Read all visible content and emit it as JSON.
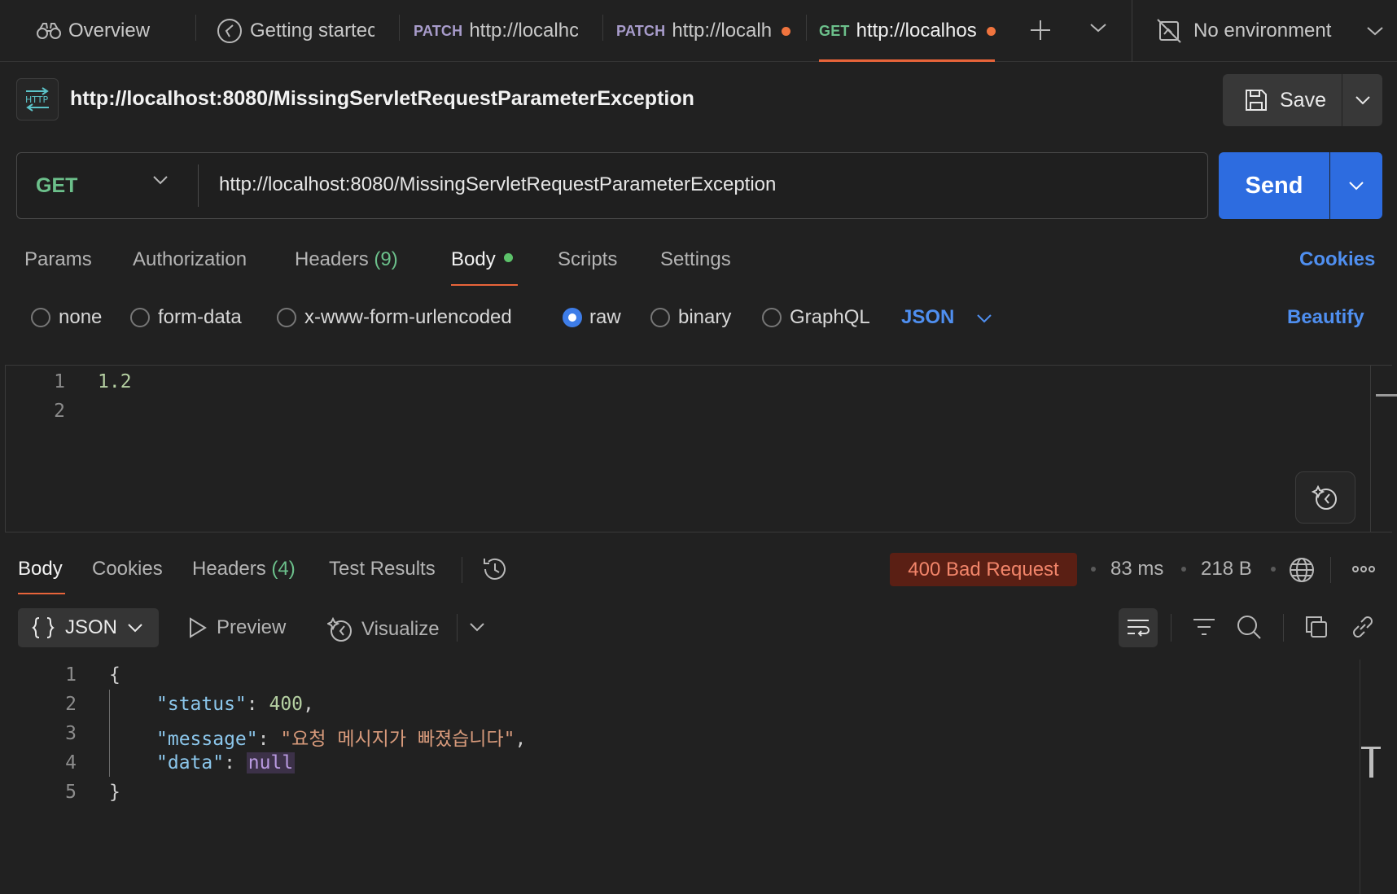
{
  "tabs": [
    {
      "label": "Overview",
      "icon": "binoculars-icon"
    },
    {
      "label": "Getting startec",
      "icon": "compass-icon"
    },
    {
      "method": "PATCH",
      "label": "http://localhc"
    },
    {
      "method": "PATCH",
      "label": "http://localh",
      "unsaved": true
    },
    {
      "method": "GET",
      "label": "http://localhos",
      "unsaved": true,
      "active": true
    }
  ],
  "environment": {
    "label": "No environment",
    "icon": "no-environment-icon"
  },
  "request": {
    "title": "http://localhost:8080/MissingServletRequestParameterException",
    "save_label": "Save",
    "method": "GET",
    "url": "http://localhost:8080/MissingServletRequestParameterException",
    "send_label": "Send"
  },
  "request_tabs": [
    {
      "label": "Params"
    },
    {
      "label": "Authorization"
    },
    {
      "label": "Headers",
      "count": "(9)"
    },
    {
      "label": "Body",
      "active": true
    },
    {
      "label": "Scripts"
    },
    {
      "label": "Settings"
    }
  ],
  "cookies_link": "Cookies",
  "body_types": [
    "none",
    "form-data",
    "x-www-form-urlencoded",
    "raw",
    "binary",
    "GraphQL"
  ],
  "body_type_selected": "raw",
  "body_format": "JSON",
  "beautify_label": "Beautify",
  "request_body_lines": [
    "1.2",
    ""
  ],
  "response_tabs": [
    {
      "label": "Body",
      "active": true
    },
    {
      "label": "Cookies"
    },
    {
      "label": "Headers",
      "count": "(4)"
    },
    {
      "label": "Test Results"
    }
  ],
  "response_status": "400 Bad Request",
  "response_time": "83 ms",
  "response_size": "218 B",
  "response_view": {
    "format": "JSON",
    "preview_label": "Preview",
    "visualize_label": "Visualize"
  },
  "response_body": {
    "open_brace": "{",
    "close_brace": "}",
    "status_key": "\"status\"",
    "status_value": "400",
    "message_key": "\"message\"",
    "message_value": "\"요청 메시지가 빠졌습니다\"",
    "data_key": "\"data\"",
    "data_value": "null"
  },
  "colors": {
    "accent": "#e8643a",
    "send": "#2d6ce0",
    "get_method": "#6cc08b",
    "link": "#4f8ff0",
    "error_badge_bg": "#5a1f14",
    "error_badge_text": "#f2856a"
  }
}
